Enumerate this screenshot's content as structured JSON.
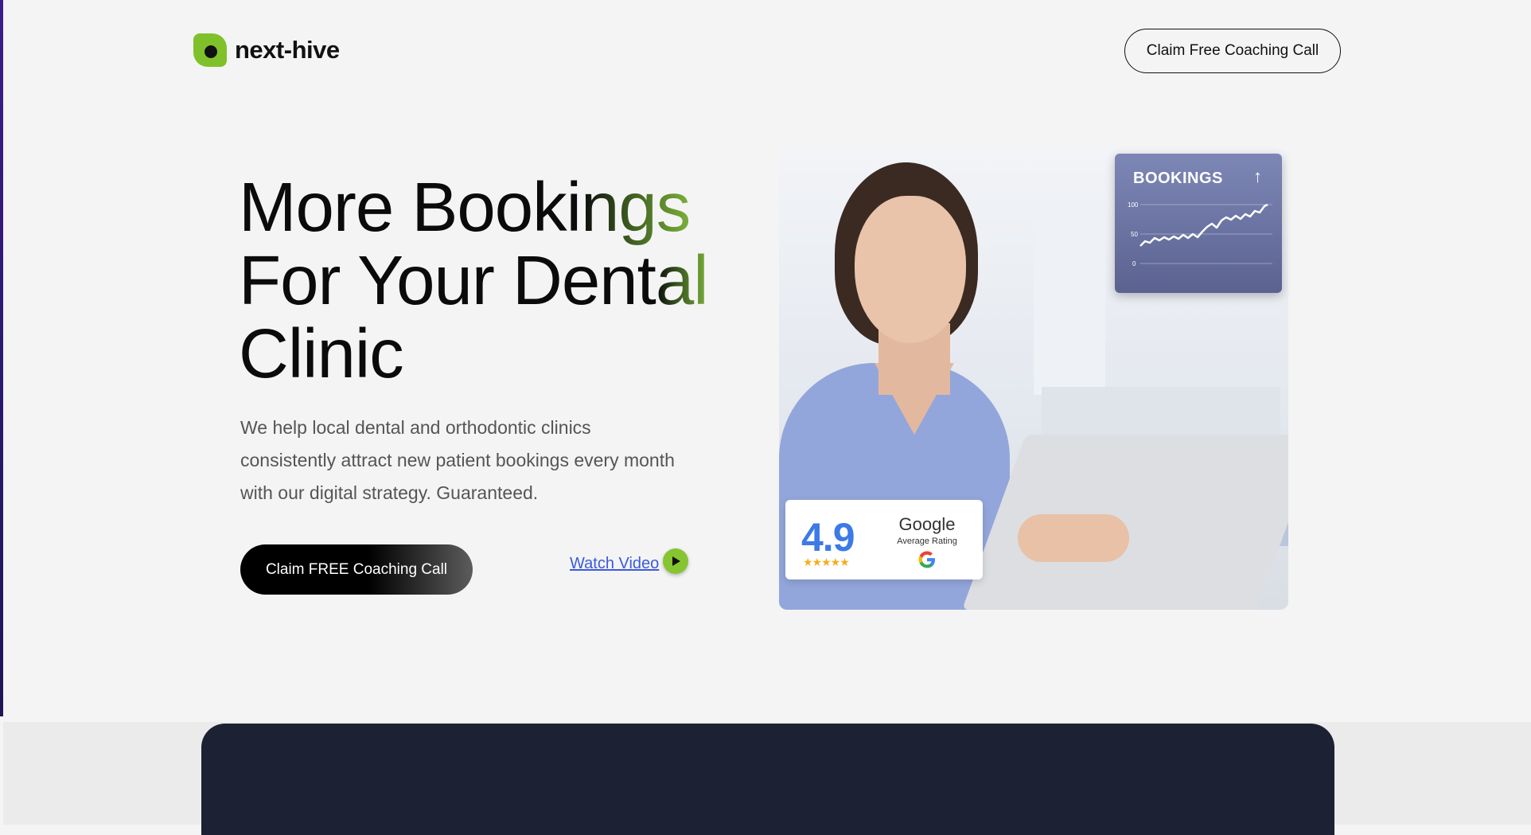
{
  "brand": {
    "name": "next-hive",
    "accent": "#7fc12b"
  },
  "header": {
    "cta_label": "Claim Free Coaching Call"
  },
  "hero": {
    "title_line1_plain": "More Booki",
    "title_line1_accent": "ngs",
    "title_line2_plain": "For Your Dent",
    "title_line2_accent": "al",
    "title_line3": "Clinic",
    "subtitle": "We help local dental and orthodontic clinics consistently attract new patient bookings every month with our digital strategy. Guaranteed.",
    "cta_label": "Claim FREE Coaching Call",
    "video_link": "Watch Video"
  },
  "bookings_card": {
    "title": "BOOKINGS",
    "arrow": "↑",
    "y_ticks": [
      "100",
      "50",
      "0"
    ]
  },
  "rating_card": {
    "value": "4.9",
    "stars": "★★★★★",
    "provider": "Google",
    "caption": "Average Rating"
  },
  "colors": {
    "dark_panel": "#1c2233",
    "link": "#3a5ae0",
    "rating_value": "#3d7ae6",
    "star": "#f2b01e"
  },
  "icons": [
    "logo-icon",
    "play-icon",
    "arrow-up-icon",
    "google-g-icon"
  ]
}
